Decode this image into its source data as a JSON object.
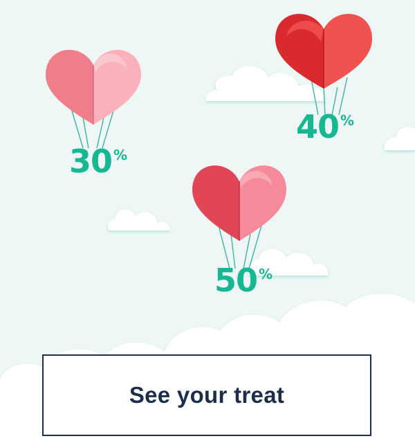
{
  "balloons": [
    {
      "id": "d30",
      "value": "30",
      "symbol": "%",
      "heart_color": "pink"
    },
    {
      "id": "d40",
      "value": "40",
      "symbol": "%",
      "heart_color": "red"
    },
    {
      "id": "d50",
      "value": "50",
      "symbol": "%",
      "heart_color": "coral-pink"
    }
  ],
  "cta": {
    "label": "See your treat"
  },
  "colors": {
    "background": "#eef7f6",
    "discount_text": "#18b794",
    "cta_text": "#1c2e4a",
    "cta_border": "#1c2e4a"
  }
}
